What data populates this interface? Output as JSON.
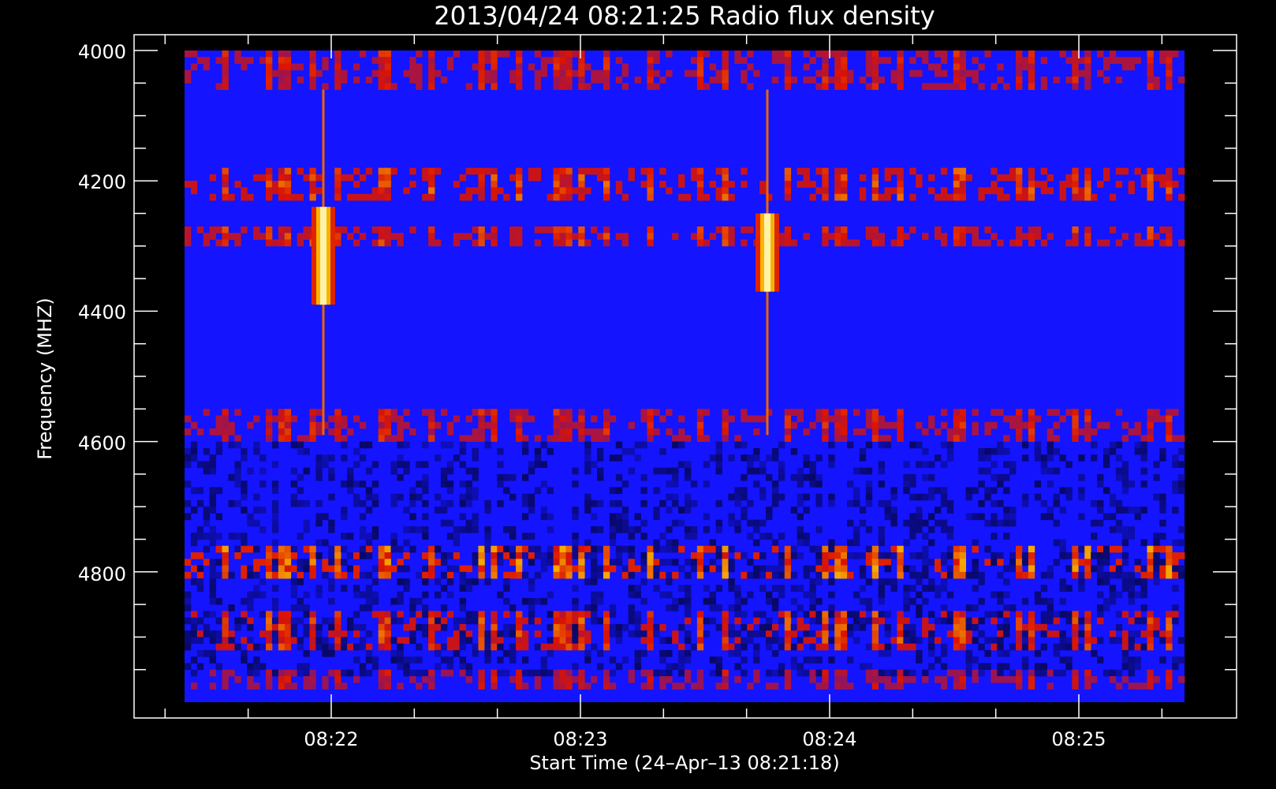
{
  "chart_data": {
    "type": "heatmap",
    "title": "2013/04/24 08:21:25 Radio flux density",
    "xlabel": "Start Time (24–Apr–13 08:21:18)",
    "ylabel": "Frequency (MHZ)",
    "x_tick_labels": [
      "08:22",
      "08:23",
      "08:24",
      "08:25"
    ],
    "y_tick_labels": [
      "4000",
      "4200",
      "4400",
      "4600",
      "4800"
    ],
    "y_ticks": [
      4000,
      4200,
      4400,
      4600,
      4800
    ],
    "y_range": [
      3975,
      5000
    ],
    "x_range_minutes": [
      "08:21:18",
      "08:25:42"
    ],
    "y_reversed": true,
    "colormap": [
      "#000000",
      "#0000ff",
      "#ff0000",
      "#ffff00",
      "#ffffff"
    ],
    "colors": {
      "background": "#000000",
      "foreground": "#ffffff",
      "base": "#1414ff"
    },
    "bands_mhz": [
      {
        "y": [
          4000,
          4060
        ],
        "intensity": 0.5
      },
      {
        "y": [
          4185,
          4225
        ],
        "intensity": 0.6
      },
      {
        "y": [
          4270,
          4300
        ],
        "intensity": 0.55
      },
      {
        "y": [
          4550,
          4600
        ],
        "intensity": 0.5
      },
      {
        "y": [
          4760,
          4810
        ],
        "intensity": 0.7
      },
      {
        "y": [
          4860,
          4920
        ],
        "intensity": 0.6
      },
      {
        "y": [
          4950,
          4975
        ],
        "intensity": 0.45
      }
    ],
    "bursts": [
      {
        "time": "08:21:58",
        "freq_mhz": [
          4240,
          4390
        ],
        "peak": 1.0
      },
      {
        "time": "08:23:45",
        "freq_mhz": [
          4250,
          4370
        ],
        "peak": 1.0
      }
    ]
  }
}
